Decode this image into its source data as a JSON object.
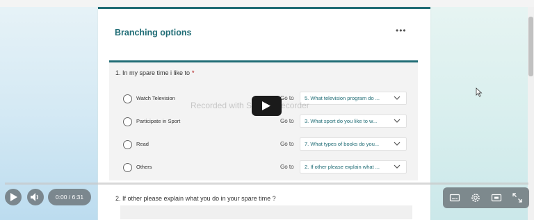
{
  "form": {
    "section_title": "Branching options",
    "more_label": "•••",
    "question1": {
      "title": "1. In my spare time i like to",
      "required_mark": "*",
      "options": [
        {
          "label": "Watch Television",
          "goto_label": "Go to",
          "goto_value": "5. What television program do ..."
        },
        {
          "label": "Participate in Sport",
          "goto_label": "Go to",
          "goto_value": "3. What sport do you like to w..."
        },
        {
          "label": "Read",
          "goto_label": "Go to",
          "goto_value": "7. What types of books do you..."
        },
        {
          "label": "Others",
          "goto_label": "Go to",
          "goto_value": "2. If other please explain what ..."
        }
      ]
    },
    "question2": {
      "title": "2. If other please explain what you do in your spare time ?"
    }
  },
  "video": {
    "watermark": "Recorded with  Screen Recorder",
    "time": "0:00 / 6:31",
    "progress": 0
  },
  "icons": {
    "play": "play-icon",
    "volume": "volume-icon",
    "captions": "captions-icon",
    "settings": "gear-icon",
    "miniplayer": "miniplayer-icon",
    "fullscreen": "fullscreen-icon"
  },
  "colors": {
    "accent": "#1f6c75",
    "required": "#a80000",
    "controls_bg": "#6e787d"
  }
}
